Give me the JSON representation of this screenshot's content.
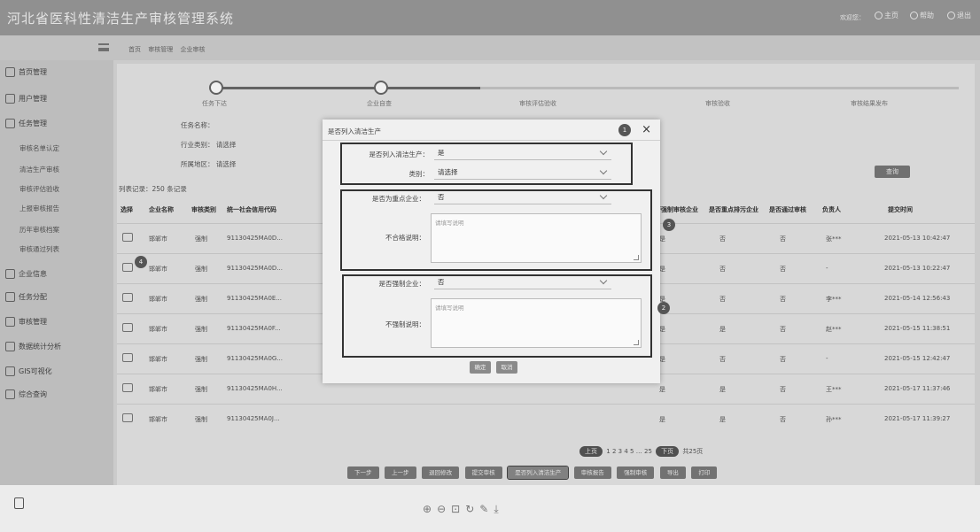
{
  "app": {
    "title": "河北省医科性清洁生产审核管理系统",
    "user": "欢迎您：",
    "header_buttons": [
      "主页",
      "帮助",
      "退出"
    ]
  },
  "breadcrumb": [
    "首页",
    "审核管理",
    "企业审核"
  ],
  "sidebar": {
    "items": [
      {
        "label": "首页管理",
        "icon": "home-icon"
      },
      {
        "label": "用户管理",
        "icon": "user-icon"
      },
      {
        "label": "任务管理",
        "icon": "task-icon"
      },
      {
        "label": "企业信息",
        "icon": "building-icon"
      },
      {
        "label": "任务分配",
        "icon": "assign-icon"
      },
      {
        "label": "审核管理",
        "icon": "audit-icon"
      },
      {
        "label": "数据统计分析",
        "icon": "chart-icon"
      },
      {
        "label": "GIS可视化",
        "icon": "map-icon"
      },
      {
        "label": "综合查询",
        "icon": "query-icon"
      }
    ],
    "subitems": [
      "审核名单认定",
      "清洁生产审核",
      "审核评估验收",
      "上报审核报告",
      "历年审核档案",
      "审核通过列表"
    ]
  },
  "steps": {
    "labels": [
      "任务下达",
      "企业自查",
      "审核评估验收",
      "审核验收",
      "审核结果发布"
    ]
  },
  "form": {
    "fields": [
      {
        "label": "任务名称：",
        "value": ""
      },
      {
        "label": "行业类别：",
        "value": "请选择"
      },
      {
        "label": "所属地区：",
        "value": "请选择"
      }
    ],
    "summary": "列表记录：250  条记录",
    "search_label": "查询"
  },
  "table": {
    "headers": [
      "选择",
      "企业名称",
      "审核类别",
      "统一社会信用代码",
      "是否强制审核企业",
      "是否重点排污企业",
      "是否通过审核",
      "负责人",
      "提交时间"
    ],
    "rows": [
      {
        "name": "邯郸市",
        "type": "强制",
        "code": "91130425MA0D...",
        "c1": "是",
        "c2": "否",
        "c3": "否",
        "person": "张***",
        "time": "2021-05-13 10:42:47"
      },
      {
        "name": "邯郸市",
        "type": "强制",
        "code": "91130425MA0D...",
        "c1": "是",
        "c2": "否",
        "c3": "否",
        "person": "-",
        "time": "2021-05-13 10:22:47"
      },
      {
        "name": "邯郸市",
        "type": "强制",
        "code": "91130425MA0E...",
        "c1": "是",
        "c2": "否",
        "c3": "否",
        "person": "李***",
        "time": "2021-05-14 12:56:43"
      },
      {
        "name": "邯郸市",
        "type": "强制",
        "code": "91130425MA0F...",
        "c1": "是",
        "c2": "是",
        "c3": "否",
        "person": "赵***",
        "time": "2021-05-15 11:38:51"
      },
      {
        "name": "邯郸市",
        "type": "强制",
        "code": "91130425MA0G...",
        "c1": "是",
        "c2": "否",
        "c3": "否",
        "person": "-",
        "time": "2021-05-15 12:42:47"
      },
      {
        "name": "邯郸市",
        "type": "强制",
        "code": "91130425MA0H...",
        "c1": "是",
        "c2": "是",
        "c3": "否",
        "person": "王***",
        "time": "2021-05-17 11:37:46"
      },
      {
        "name": "邯郸市",
        "type": "强制",
        "code": "91130425MA0J...",
        "c1": "是",
        "c2": "是",
        "c3": "否",
        "person": "孙***",
        "time": "2021-05-17 11:39:27"
      }
    ]
  },
  "pagination": {
    "prev": "上页",
    "pages": [
      "1",
      "2",
      "3",
      "4",
      "5",
      "25"
    ],
    "next": "下页",
    "total": "共25页"
  },
  "bottom_buttons": [
    "下一步",
    "上一步",
    "退回修改",
    "提交审核",
    "是否列入清洁生产",
    "审核报告",
    "强制审核",
    "导出",
    "打印"
  ],
  "modal": {
    "title": "是否列入清洁生产",
    "close": "×",
    "badges": [
      "1",
      "2",
      "3",
      "4"
    ],
    "f1_label": "是否列入清洁生产：",
    "f1_value": "是",
    "f2_label": "类别：",
    "f2_value": "请选择",
    "f3_label": "是否为重点企业：",
    "f3_value": "否",
    "f4_label": "不合格说明：",
    "f4_placeholder": "请填写说明",
    "f5_label": "是否强制企业：",
    "f5_value": "否",
    "f6_label": "不强制说明：",
    "f6_placeholder": "请填写说明",
    "btn_ok": "确定",
    "btn_cancel": "取消"
  }
}
